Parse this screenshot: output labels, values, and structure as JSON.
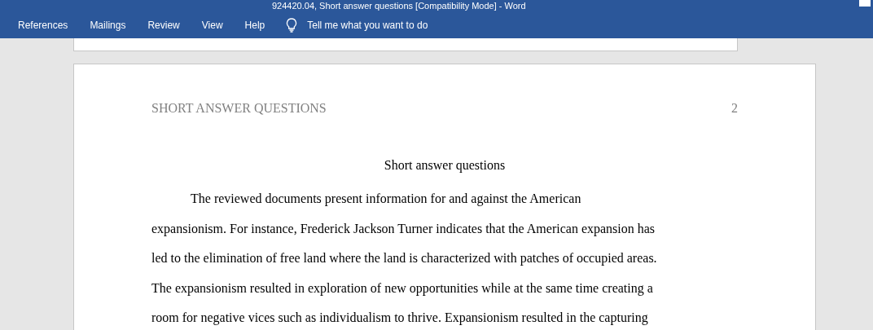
{
  "window": {
    "title": "924420.04, Short answer questions [Compatibility Mode]  -  Word"
  },
  "ribbon_tabs": [
    {
      "label": "References"
    },
    {
      "label": "Mailings"
    },
    {
      "label": "Review"
    },
    {
      "label": "View"
    },
    {
      "label": "Help"
    }
  ],
  "tell_me": {
    "placeholder": "Tell me what you want to do"
  },
  "document": {
    "header": {
      "title": "SHORT ANSWER QUESTIONS",
      "page_number": "2"
    },
    "heading": "Short answer questions",
    "paragraph_lines": [
      "The reviewed documents present information for and against the American",
      "expansionism. For instance, Frederick Jackson Turner indicates that the American expansion has",
      "led to the elimination of free land where the land is characterized with patches of occupied areas.",
      "The expansionism resulted in exploration of new opportunities while at the same time creating a",
      "room for negative vices such as individualism to thrive.  Expansionism resulted in the capturing"
    ]
  }
}
